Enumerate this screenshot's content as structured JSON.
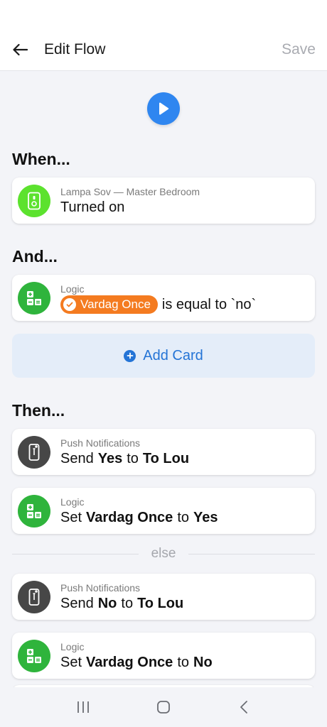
{
  "header": {
    "title": "Edit Flow",
    "save_label": "Save"
  },
  "sections": {
    "when": "When...",
    "and": "And...",
    "then": "Then..."
  },
  "when_card": {
    "icon": "light-switch-icon",
    "sub": "Lampa Sov — Master Bedroom",
    "main": "Turned on"
  },
  "and_card": {
    "icon": "logic-icon",
    "sub": "Logic",
    "token": "Vardag Once",
    "rest": "is equal to `no`"
  },
  "add_card_label": "Add Card",
  "then_cards": [
    {
      "icon": "phone-icon",
      "sub": "Push Notifications",
      "w1": "Send",
      "b1": "Yes",
      "w2": "to",
      "b2": "To Lou"
    },
    {
      "icon": "logic-icon",
      "sub": "Logic",
      "w1": "Set",
      "b1": "Vardag Once",
      "w2": "to",
      "b2": "Yes"
    }
  ],
  "else_label": "else",
  "else_cards": [
    {
      "icon": "phone-icon",
      "sub": "Push Notifications",
      "w1": "Send",
      "b1": "No",
      "w2": "to",
      "b2": "To Lou"
    },
    {
      "icon": "logic-icon",
      "sub": "Logic",
      "w1": "Set",
      "b1": "Vardag Once",
      "w2": "to",
      "b2": "No"
    }
  ],
  "colors": {
    "accent_blue": "#2f86f0",
    "token_orange": "#f47b20",
    "logic_green": "#2fb43c",
    "light_green": "#5ce22e",
    "push_dark": "#474747"
  }
}
